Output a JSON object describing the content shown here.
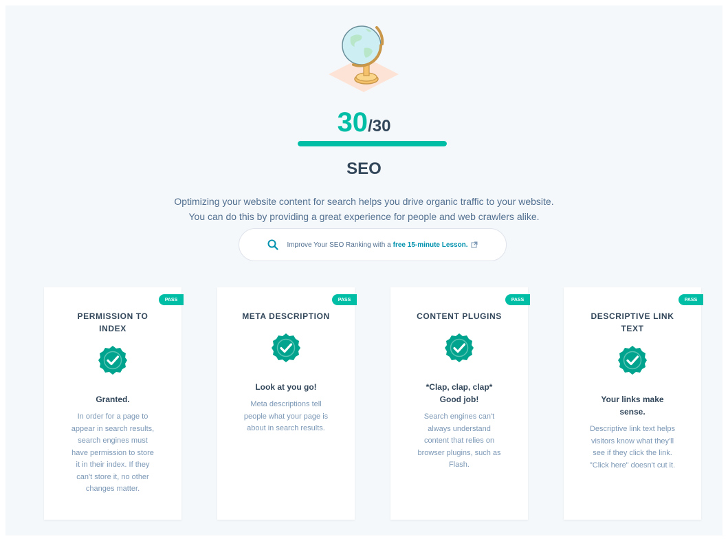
{
  "score": {
    "value": "30",
    "total": "/30",
    "fraction": 1.0
  },
  "section_title": "SEO",
  "description": {
    "line1": "Optimizing your website content for search helps you drive organic traffic to your website.",
    "line2": "You can do this by providing a great experience for people and web crawlers alike."
  },
  "lesson": {
    "prefix": "Improve Your SEO Ranking with a",
    "link": "free 15-minute Lesson."
  },
  "colors": {
    "accent": "#00bda5",
    "link": "#0091ae",
    "text": "#33475b",
    "muted": "#7c98b6"
  },
  "cards": [
    {
      "badge": "PASS",
      "title_line1": "PERMISSION TO",
      "title_line2": "INDEX",
      "headline_line1": "Granted.",
      "headline_line2": "",
      "body": [
        "In order for a page to",
        "appear in search results,",
        "search engines must",
        "have permission to store",
        "it in their index. If they",
        "can't store it, no other",
        "changes matter."
      ]
    },
    {
      "badge": "PASS",
      "title_line1": "META DESCRIPTION",
      "title_line2": "",
      "headline_line1": "Look at you go!",
      "headline_line2": "",
      "body": [
        "Meta descriptions tell",
        "people what your page is",
        "about in search results."
      ]
    },
    {
      "badge": "PASS",
      "title_line1": "CONTENT PLUGINS",
      "title_line2": "",
      "headline_line1": "*Clap, clap, clap*",
      "headline_line2": "Good job!",
      "body": [
        "Search engines can't",
        "always understand",
        "content that relies on",
        "browser plugins, such as",
        "Flash."
      ]
    },
    {
      "badge": "PASS",
      "title_line1": "DESCRIPTIVE LINK",
      "title_line2": "TEXT",
      "headline_line1": "Your links make",
      "headline_line2": "sense.",
      "body": [
        "Descriptive link text helps",
        "visitors know what they'll",
        "see if they click the link.",
        "\"Click here\" doesn't cut it."
      ]
    }
  ]
}
